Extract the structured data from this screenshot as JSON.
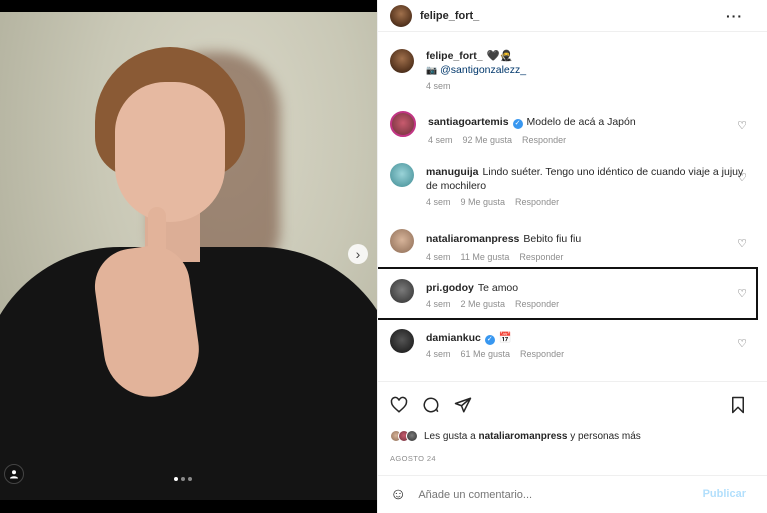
{
  "post": {
    "author": "felipe_fort_"
  },
  "caption": {
    "username": "felipe_fort_",
    "emojis": "🖤🥷",
    "camera_icon": "camera-icon",
    "mention": "@santigonzalezz_",
    "time": "4 sem"
  },
  "comments": [
    {
      "username": "santiagoartemis",
      "verified": true,
      "text": "Modelo de acá a Japón",
      "time": "4 sem",
      "likes": "92 Me gusta",
      "reply": "Responder"
    },
    {
      "username": "manuguija",
      "verified": false,
      "text": "Lindo suéter. Tengo uno idéntico de cuando viaje a jujuy de mochilero",
      "time": "4 sem",
      "likes": "9 Me gusta",
      "reply": "Responder"
    },
    {
      "username": "nataliaromanpress",
      "verified": false,
      "text": "Bebito fiu fiu",
      "time": "4 sem",
      "likes": "11 Me gusta",
      "reply": "Responder"
    },
    {
      "username": "pri.godoy",
      "verified": false,
      "text": "Te amoo",
      "time": "4 sem",
      "likes": "2 Me gusta",
      "reply": "Responder"
    },
    {
      "username": "damiankuc",
      "verified": true,
      "text": "📅",
      "time": "4 sem",
      "likes": "61 Me gusta",
      "reply": "Responder"
    }
  ],
  "likes": {
    "prefix": "Les gusta a",
    "user": "nataliaromanpress",
    "suffix": "y personas más"
  },
  "date": "AGOSTO 24",
  "add_comment": {
    "placeholder": "Añade un comentario...",
    "publish": "Publicar"
  },
  "carousel": {
    "slide_count": 3,
    "active_slide": 1
  },
  "colors": {
    "verified": "#3897f0",
    "mention": "#00376b",
    "publish_disabled": "#b2dffc",
    "meta_gray": "#8e8e8e"
  }
}
